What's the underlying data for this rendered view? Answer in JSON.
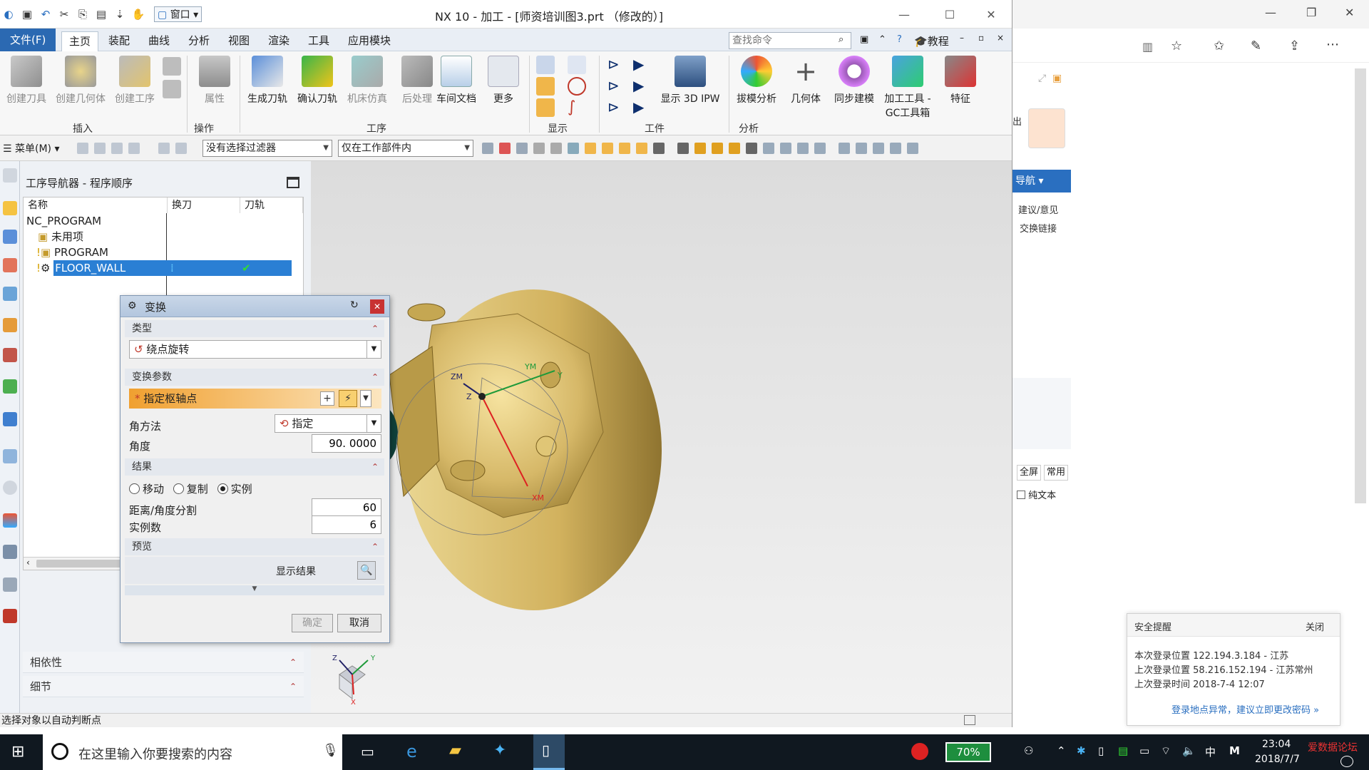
{
  "window": {
    "title": "NX 10 - 加工 - [师资培训图3.prt （修改的）]",
    "quick_access": {
      "window_label": "窗口"
    }
  },
  "menubar": {
    "file": "文件(F)",
    "tabs": [
      "主页",
      "装配",
      "曲线",
      "分析",
      "视图",
      "渲染",
      "工具",
      "应用模块"
    ],
    "search_placeholder": "查找命令",
    "tutorial": "教程"
  },
  "ribbon": {
    "buttons": {
      "create_tool": "创建刀具",
      "create_geometry": "创建几何体",
      "create_operation": "创建工序",
      "properties": "属性",
      "generate_path": "生成刀轨",
      "verify_path": "确认刀轨",
      "machine_sim": "机床仿真",
      "postprocess": "后处理",
      "shop_doc": "车间文档",
      "more": "更多",
      "show_3d_ipw": "显示 3D IPW",
      "draft_analysis": "拔模分析",
      "geometry": "几何体",
      "sync_modeling": "同步建模",
      "gc_toolkit_1": "加工工具 -",
      "gc_toolkit_2": "GC工具箱",
      "feature": "特征"
    },
    "groups": {
      "insert": "插入",
      "operations": "操作",
      "process": "工序",
      "display": "显示",
      "workpiece": "工件",
      "analysis": "分析"
    }
  },
  "toolbar2": {
    "menu": "菜单(M)",
    "filter": "没有选择过滤器",
    "scope": "仅在工作部件内"
  },
  "navigator": {
    "title": "工序导航器 - 程序顺序",
    "columns": [
      "名称",
      "换刀",
      "刀轨"
    ],
    "rows": [
      {
        "name": "NC_PROGRAM"
      },
      {
        "name": "未用项"
      },
      {
        "name": "PROGRAM"
      },
      {
        "name": "FLOOR_WALL",
        "toolchange": "⁞",
        "path": "✔"
      }
    ],
    "panels": {
      "dependency": "相依性",
      "details": "细节"
    }
  },
  "dialog": {
    "title": "变换",
    "sections": {
      "type": "类型",
      "params": "变换参数",
      "result": "结果",
      "preview": "预览"
    },
    "type_value": "绕点旋转",
    "pivot_label": "指定枢轴点",
    "angle_method_label": "角方法",
    "angle_method_value": "指定",
    "angle_label": "角度",
    "angle_value": "90. 0000",
    "result_options": [
      "移动",
      "复制",
      "实例"
    ],
    "result_selected": "实例",
    "distance_label": "距离/角度分割",
    "distance_value": "60",
    "instances_label": "实例数",
    "instances_value": "6",
    "show_result": "显示结果",
    "ok": "确定",
    "cancel": "取消"
  },
  "axes": {
    "zm": "ZM",
    "ym": "YM",
    "xm": "XM",
    "z": "Z",
    "y": "Y",
    "x": "X"
  },
  "statusbar": {
    "text": "选择对象以自动判断点"
  },
  "browser": {
    "nav_label": "导航",
    "links": [
      "建议/意见",
      "交换链接"
    ],
    "fullscreen": "全屏",
    "common": "常用",
    "plain_text": "纯文本",
    "partial_text": "出",
    "security": {
      "title": "安全提醒",
      "close": "关闭",
      "line1": "本次登录位置 122.194.3.184 - 江苏",
      "line2": "上次登录位置 58.216.152.194 - 江苏常州",
      "line3": "上次登录时间 2018-7-4 12:07",
      "link": "登录地点异常，建议立即更改密码 »"
    }
  },
  "taskbar": {
    "search_placeholder": "在这里输入你要搜索的内容",
    "battery": "70%",
    "ime": "中",
    "time": "23:04",
    "date": "2018/7/7",
    "watermark": "爱数据论坛"
  }
}
